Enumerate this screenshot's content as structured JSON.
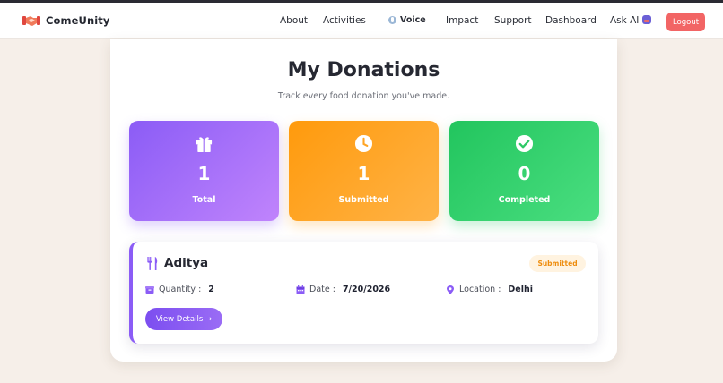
{
  "nav": {
    "brand": "ComeUnity",
    "about": "About",
    "activities": "Activities",
    "voice": "Voice",
    "impact": "Impact",
    "support": "Support",
    "dashboard": "Dashboard",
    "ask_ai": "Ask AI",
    "logout": "Logout"
  },
  "page": {
    "title": "My Donations",
    "subtitle": "Track every food donation you've made."
  },
  "stats": [
    {
      "value": "1",
      "label": "Total",
      "icon": "gift-icon",
      "color": "#8b5cf6"
    },
    {
      "value": "1",
      "label": "Submitted",
      "icon": "clock-icon",
      "color": "#ff9a0c"
    },
    {
      "value": "0",
      "label": "Completed",
      "icon": "check-circle-icon",
      "color": "#22c55e"
    }
  ],
  "donations": [
    {
      "name": "Aditya",
      "status": "Submitted",
      "quantity_label": "Quantity :",
      "quantity": "2",
      "date_label": "Date :",
      "date": "7/20/2026",
      "location_label": "Location :",
      "location": "Delhi",
      "view_details": "View Details →"
    }
  ],
  "colors": {
    "accent": "#8b5cf6",
    "logout": "#f26565",
    "background": "#f6efe9"
  }
}
